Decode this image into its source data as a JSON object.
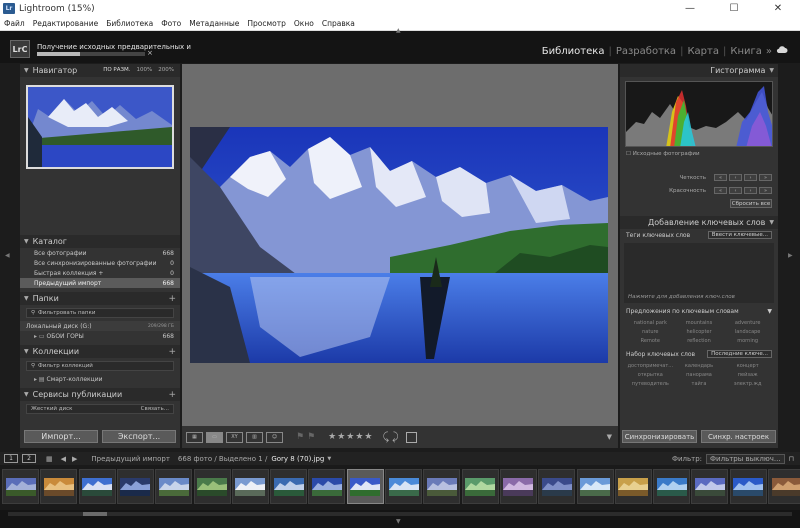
{
  "window": {
    "title": "Lightroom (15%)",
    "icon_text": "Lr",
    "controls": [
      "—",
      "☐",
      "✕"
    ]
  },
  "menu": [
    "Файл",
    "Редактирование",
    "Библиотека",
    "Фото",
    "Метаданные",
    "Просмотр",
    "Окно",
    "Справка"
  ],
  "identity": {
    "logo": "LrC",
    "progress_text": "Получение исходных предварительных и",
    "progress_fraction": 0.4,
    "cancel": "×"
  },
  "modules": {
    "items": [
      "Библиотека",
      "Разработка",
      "Карта",
      "Книга"
    ],
    "active": "Библиотека",
    "more": "»"
  },
  "navigator": {
    "title": "Навигатор",
    "options": [
      "ПО РАЗМ.",
      "100%",
      "200%"
    ]
  },
  "catalog": {
    "title": "Каталог",
    "rows": [
      {
        "label": "Все фотографии",
        "count": "668"
      },
      {
        "label": "Все синхронизированные фотографии",
        "count": "0"
      },
      {
        "label": "Быстрая коллекция  +",
        "count": "0"
      },
      {
        "label": "Предыдущий импорт",
        "count": "668"
      }
    ]
  },
  "folders": {
    "title": "Папки",
    "filter": "Фильтровать папки",
    "disk": "Локальный диск (G:)",
    "disk_size": "209/298 ГБ",
    "folder": "ОБОИ ГОРЫ",
    "folder_count": "668"
  },
  "collections": {
    "title": "Коллекции",
    "filter": "Фильтр коллекций",
    "smart": "Смарт-коллекции"
  },
  "publish": {
    "title": "Сервисы публикации",
    "hdd": "Жесткий диск",
    "setup": "Связать..."
  },
  "left_buttons": {
    "import": "Импорт...",
    "export": "Экспорт..."
  },
  "toolbar": {
    "stars": "★★★★★"
  },
  "histogram": {
    "title": "Гистограмма",
    "original": "Исходные фотографии"
  },
  "quick": {
    "rows": [
      "Четкость",
      "Красочность"
    ],
    "reset": "Сбросить все"
  },
  "keywording": {
    "title": "Добавление ключевых слов",
    "tags_label": "Теги ключевых слов",
    "tags_dd": "Ввести ключевые...",
    "hint": "Нажмите для добавления ключ.слов",
    "suggestions_title": "Предложения по ключевым словам",
    "suggestions": [
      "national park",
      "mountains",
      "adventure",
      "nature",
      "helicopter",
      "landscape",
      "Remote",
      "reflection",
      "morning"
    ],
    "set_label": "Набор ключевых слов",
    "set_dd": "Последние ключе...",
    "set": [
      "достопримечат...",
      "календарь",
      "концерт",
      "открытка",
      "панорама",
      "пейзаж",
      "путеводитель",
      "тайга",
      "электр.жд"
    ]
  },
  "right_buttons": {
    "sync": "Синхронизировать",
    "sync_settings": "Синхр. настроек"
  },
  "filmstrip_bar": {
    "pages": [
      "1",
      "2"
    ],
    "source": "Предыдущий импорт",
    "info": "668 фото / Выделено 1 /",
    "file": "Gory 8 (70).jpg",
    "filter_label": "Фильтр:",
    "filter_value": "Фильтры выключ..."
  },
  "thumbs": 21,
  "selected_thumb": 9
}
